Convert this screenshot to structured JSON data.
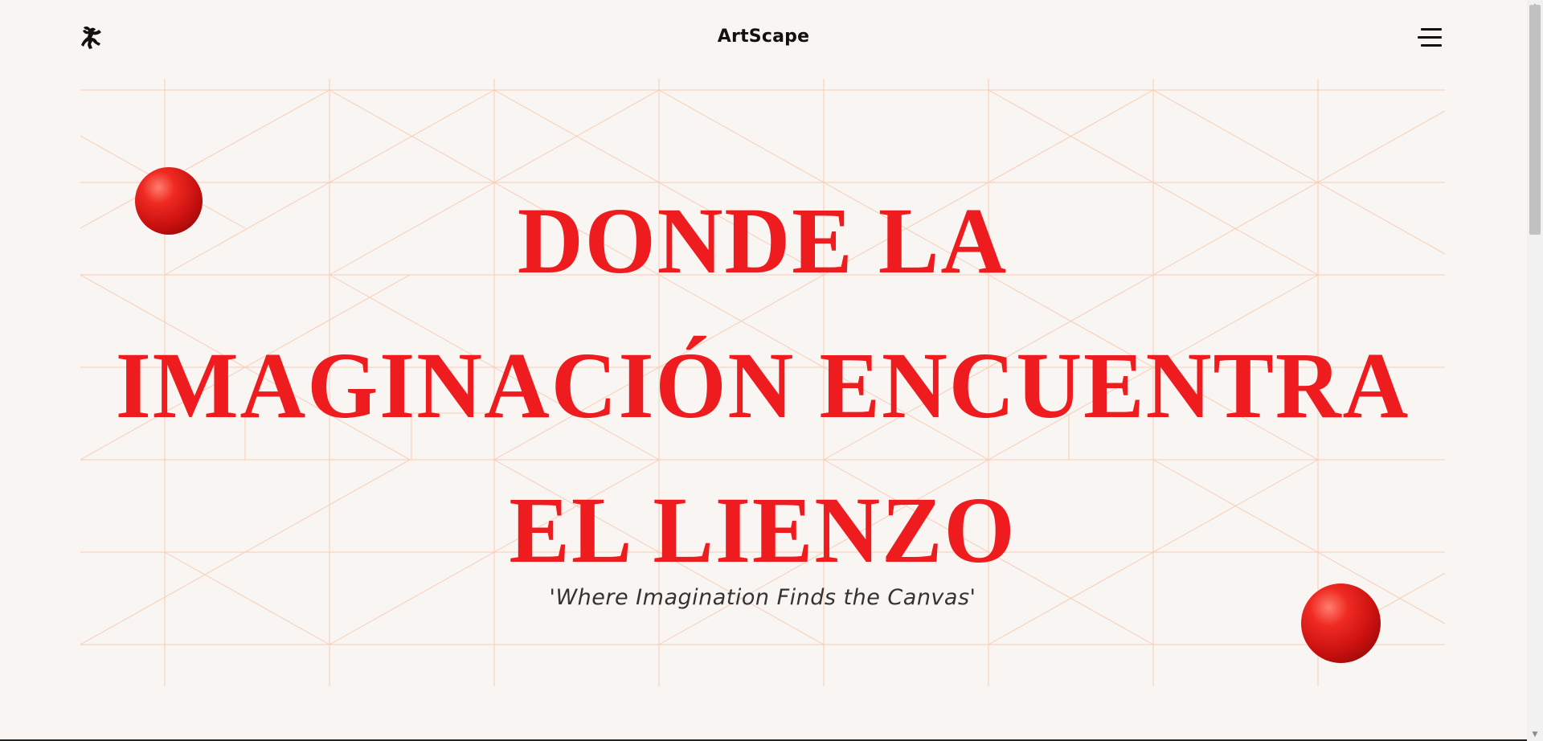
{
  "header": {
    "logo_icon": "leaping-figure-logo-icon",
    "brand": "ArtScape",
    "menu_icon": "hamburger-menu-icon"
  },
  "hero": {
    "title_lines": [
      "DONDE LA",
      "IMAGINACIÓN ENCUENTRA",
      "EL LIENZO"
    ],
    "subtitle": "'Where Imagination Finds the Canvas'"
  },
  "colors": {
    "background": "#f9f5f2",
    "accent": "#ee1c1f",
    "grid_lines": "#f7cdb4",
    "text_dark": "#111111"
  }
}
